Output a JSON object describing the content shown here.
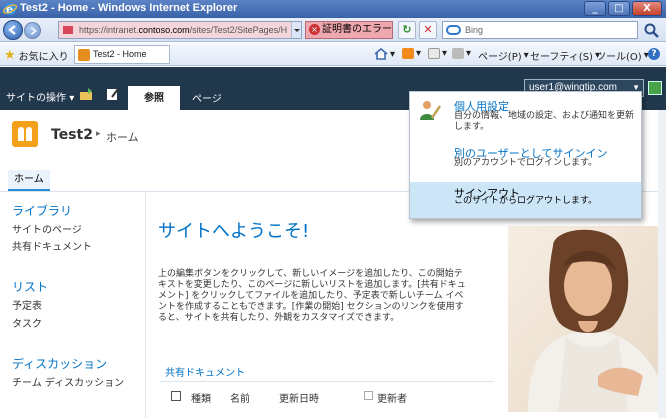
{
  "window": {
    "title": "Test2 - Home - Windows Internet Explorer",
    "buttons": [
      "_",
      "□",
      "X"
    ]
  },
  "address_bar": {
    "url_prefix": "https://intranet.",
    "url_domain": "contoso.com",
    "url_rest": "/sites/Test2/SitePages/H",
    "cert_error": "証明書のエラー",
    "search_placeholder": "Bing"
  },
  "favorites_bar": {
    "favorites_label": "お気に入り",
    "tab_label": "Test2 - Home",
    "commands": [
      "ページ(P)",
      "セーフティ(S)",
      "ツール(O)"
    ]
  },
  "ribbon": {
    "site_actions": "サイトの操作",
    "tabs": [
      "参照",
      "ページ"
    ],
    "user": "user1@wingtip.com"
  },
  "site": {
    "title": "Test2",
    "breadcrumb": "ホーム",
    "top_nav_home": "ホーム"
  },
  "left_nav": {
    "library_heading": "ライブラリ",
    "library_items": [
      "サイトのページ",
      "共有ドキュメント"
    ],
    "lists_heading": "リスト",
    "lists_items": [
      "予定表",
      "タスク"
    ],
    "discussion_heading": "ディスカッション",
    "discussion_items": [
      "チーム ディスカッション"
    ]
  },
  "content": {
    "welcome": "サイトへようこそ!",
    "body": "上の編集ボタンをクリックして、新しいイメージを追加したり、この開始テキストを変更したり、このページに新しいリストを追加します。[共有ドキュメント] をクリックしてファイルを追加したり、予定表で新しいチーム イベントを作成することもできます。[作業の開始] セクションのリンクを使用すると、サイトを共有したり、外観をカスタマイズできます。",
    "doc_library_title": "共有ドキュメント",
    "columns": [
      "種類",
      "名前",
      "更新日時",
      "更新者"
    ]
  },
  "user_menu": {
    "items": [
      {
        "title": "個人用設定",
        "desc": "自分の情報、地域の設定、および通知を更新します。"
      },
      {
        "title": "別のユーザーとしてサインイン",
        "desc": "別のアカウントでログインします。"
      },
      {
        "title": "サインアウト",
        "desc": "このサイトからログアウトします。"
      }
    ],
    "highlighted_index": 2
  },
  "colors": {
    "ribbon": "#21374c",
    "link_blue": "#0072c6",
    "menu_highlight": "#cde6f7",
    "cert_error_bg": "#f0a8b0"
  }
}
